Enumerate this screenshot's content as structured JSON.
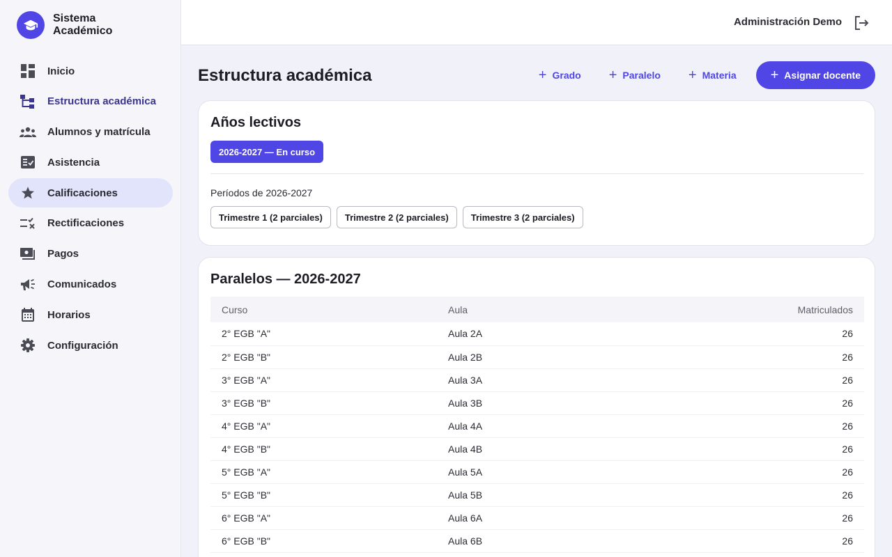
{
  "app": {
    "name_line1": "Sistema",
    "name_line2": "Académico"
  },
  "colors": {
    "accent": "#4f46e5",
    "selected_bg": "#e2e4fb"
  },
  "sidebar": {
    "items": [
      {
        "label": "Inicio",
        "icon": "dashboard-icon"
      },
      {
        "label": "Estructura académica",
        "icon": "hierarchy-icon"
      },
      {
        "label": "Alumnos y matrícula",
        "icon": "people-icon"
      },
      {
        "label": "Asistencia",
        "icon": "checklist-icon"
      },
      {
        "label": "Calificaciones",
        "icon": "star-icon"
      },
      {
        "label": "Rectificaciones",
        "icon": "rule-edit-icon"
      },
      {
        "label": "Pagos",
        "icon": "payments-icon"
      },
      {
        "label": "Comunicados",
        "icon": "megaphone-icon"
      },
      {
        "label": "Horarios",
        "icon": "calendar-icon"
      },
      {
        "label": "Configuración",
        "icon": "gear-icon"
      }
    ]
  },
  "header": {
    "user": "Administración Demo"
  },
  "page": {
    "title": "Estructura académica",
    "actions": {
      "grado": "Grado",
      "paralelo": "Paralelo",
      "materia": "Materia",
      "asignar": "Asignar docente"
    }
  },
  "years": {
    "title": "Años lectivos",
    "current": "2026-2027 — En curso",
    "periods_label": "Períodos de 2026-2027",
    "periods": [
      "Trimestre 1 (2 parciales)",
      "Trimestre 2 (2 parciales)",
      "Trimestre 3 (2 parciales)"
    ]
  },
  "paralelos": {
    "title": "Paralelos — 2026-2027",
    "columns": {
      "curso": "Curso",
      "aula": "Aula",
      "matriculados": "Matriculados"
    },
    "rows": [
      {
        "curso": "2° EGB \"A\"",
        "aula": "Aula 2A",
        "matriculados": "26"
      },
      {
        "curso": "2° EGB \"B\"",
        "aula": "Aula 2B",
        "matriculados": "26"
      },
      {
        "curso": "3° EGB \"A\"",
        "aula": "Aula 3A",
        "matriculados": "26"
      },
      {
        "curso": "3° EGB \"B\"",
        "aula": "Aula 3B",
        "matriculados": "26"
      },
      {
        "curso": "4° EGB \"A\"",
        "aula": "Aula 4A",
        "matriculados": "26"
      },
      {
        "curso": "4° EGB \"B\"",
        "aula": "Aula 4B",
        "matriculados": "26"
      },
      {
        "curso": "5° EGB \"A\"",
        "aula": "Aula 5A",
        "matriculados": "26"
      },
      {
        "curso": "5° EGB \"B\"",
        "aula": "Aula 5B",
        "matriculados": "26"
      },
      {
        "curso": "6° EGB \"A\"",
        "aula": "Aula 6A",
        "matriculados": "26"
      },
      {
        "curso": "6° EGB \"B\"",
        "aula": "Aula 6B",
        "matriculados": "26"
      }
    ]
  }
}
